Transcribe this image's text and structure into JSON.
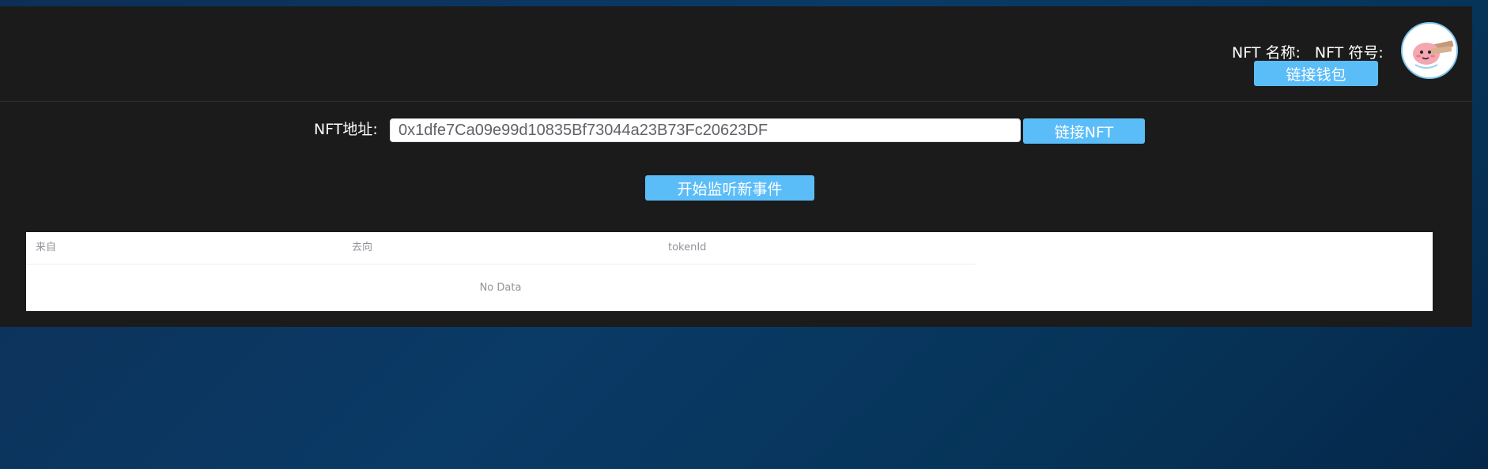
{
  "header": {
    "nft_name_label": "NFT 名称:",
    "nft_symbol_label": "NFT 符号:",
    "connect_wallet_label": "链接钱包"
  },
  "form": {
    "address_label": "NFT地址:",
    "address_value": "0x1dfe7Ca09e99d10835Bf73044a23B73Fc20623DF",
    "connect_nft_label": "链接NFT",
    "start_listen_label": "开始监听新事件"
  },
  "table": {
    "columns": [
      "来自",
      "去向",
      "tokenId"
    ],
    "empty_text": "No Data"
  },
  "colors": {
    "accent": "#5bbdf8",
    "panel": "#1b1b1b",
    "background": "#0a3a66"
  },
  "icons": {
    "avatar": "cartoon-avatar-icon"
  }
}
